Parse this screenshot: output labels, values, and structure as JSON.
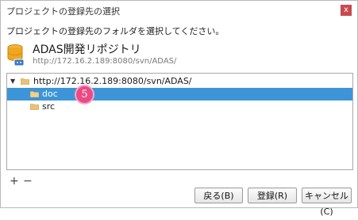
{
  "window": {
    "title": "プロジェクトの登録先の選択",
    "close_label": "x"
  },
  "instruction": "プロジェクトの登録先のフォルダを選択してください。",
  "repository": {
    "name": "ADAS開発リポジトリ",
    "url": "http://172.16.2.189:8080/svn/ADAS/"
  },
  "tree": {
    "nodes": [
      {
        "label": "http://172.16.2.189:8080/svn/ADAS/",
        "expanded": true,
        "selected": false
      },
      {
        "label": "doc",
        "selected": true
      },
      {
        "label": "src",
        "selected": false
      }
    ]
  },
  "annotation": {
    "step": "5",
    "color": "#e94b86"
  },
  "toolbar": {
    "add_label": "+",
    "remove_label": "−"
  },
  "buttons": {
    "back": "戻る(B)",
    "register": "登録(R)",
    "cancel": "キャンセル(C)"
  },
  "colors": {
    "selection": "#3d95d7",
    "close_button": "#c74a4f"
  },
  "icons": [
    "repository-icon",
    "folder-icon",
    "expand-arrow-icon",
    "close-icon"
  ]
}
